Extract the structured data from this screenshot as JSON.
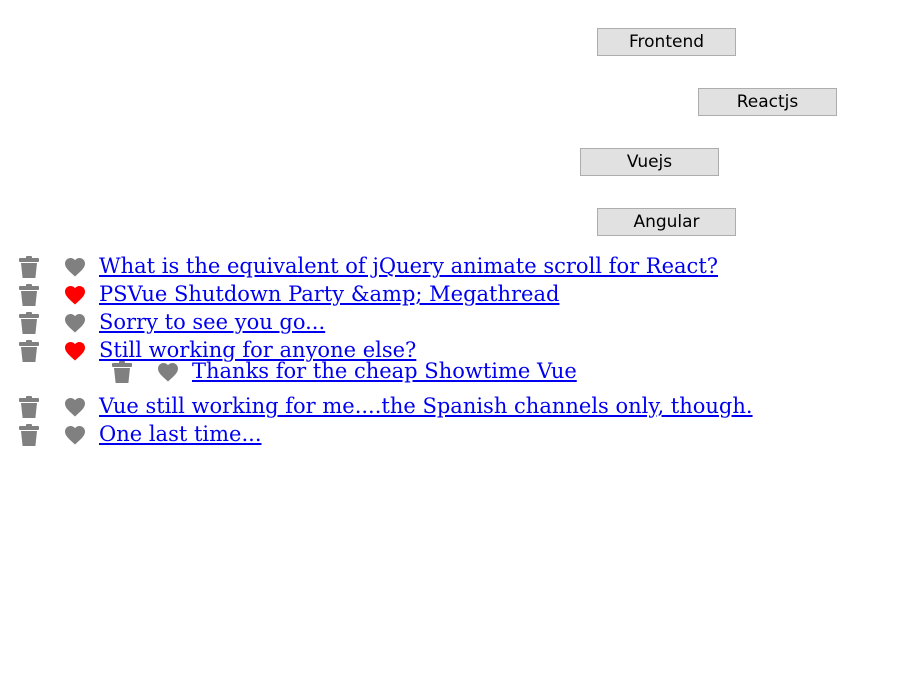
{
  "categories": {
    "frontend": "Frontend",
    "reactjs": "Reactjs",
    "vuejs": "Vuejs",
    "angular": "Angular"
  },
  "posts": [
    {
      "title": "What is the equivalent of jQuery animate scroll for React?",
      "liked": false
    },
    {
      "title": "PSVue Shutdown Party &amp; Megathread",
      "liked": true
    },
    {
      "title": "Sorry to see you go...",
      "liked": false
    },
    {
      "title": "Still working for anyone else?",
      "liked": true
    },
    {
      "title": "Thanks for the cheap Showtime Vue",
      "liked": false
    },
    {
      "title": "Vue still working for me....the Spanish channels only, though.",
      "liked": false
    },
    {
      "title": "One last time...",
      "liked": false
    }
  ],
  "colors": {
    "icon_gray": "#808080",
    "heart_liked": "#ff0000",
    "link": "#0000ee",
    "button_bg": "#e1e1e1",
    "button_border": "#adadad"
  },
  "icons": {
    "delete": "trash-icon",
    "like": "heart-icon"
  }
}
